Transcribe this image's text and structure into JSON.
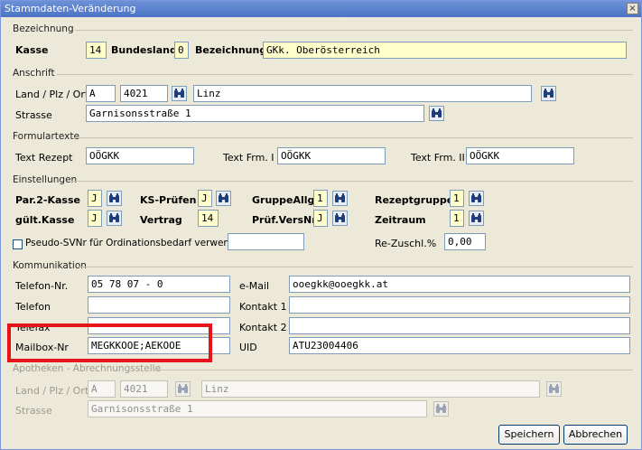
{
  "window": {
    "title": "Stammdaten-Veränderung",
    "close_glyph": "×"
  },
  "bezeichnung": {
    "group_label": "Bezeichnung",
    "kasse_label": "Kasse",
    "kasse_value": "14",
    "bundesland_label": "Bundesland",
    "bundesland_value": "0",
    "bezeichnung_label": "Bezeichnung",
    "bezeichnung_value": "GKk. Oberösterreich"
  },
  "anschrift": {
    "group_label": "Anschrift",
    "lpo_label": "Land / Plz / Ort",
    "land": "A",
    "plz": "4021",
    "ort": "Linz",
    "strasse_label": "Strasse",
    "strasse": "Garnisonsstraße 1"
  },
  "formulartexte": {
    "group_label": "Formulartexte",
    "rezept_label": "Text Rezept",
    "rezept": "OÖGKK",
    "frm1_label": "Text Frm. I",
    "frm1": "OÖGKK",
    "frm2_label": "Text Frm. II",
    "frm2": "OÖGKK"
  },
  "einstellungen": {
    "group_label": "Einstellungen",
    "par2_label": "Par.2-Kasse",
    "par2": "J",
    "ksp_label": "KS-Prüfen",
    "ksp": "J",
    "gruppe_label": "GruppeAllg",
    "gruppe": "1",
    "rezeptgruppe_label": "Rezeptgruppe",
    "rezeptgruppe": "1",
    "gueltig_label": "gült.Kasse",
    "gueltig": "J",
    "vertrag_label": "Vertrag",
    "vertrag": "14",
    "pruef_label": "Prüf.VersNr",
    "pruef": "J",
    "zeitraum_label": "Zeitraum",
    "zeitraum": "1",
    "pseudo_label": "Pseudo-SVNr für Ordinationsbedarf verwenden:",
    "pseudo_value": "",
    "rezuschl_label": "Re-Zuschl.%",
    "rezuschl": "0,00"
  },
  "kommunikation": {
    "group_label": "Kommunikation",
    "telefon_nr_label": "Telefon-Nr.",
    "telefon_nr": "05 78 07 - 0",
    "telefon_label": "Telefon",
    "telefon": "",
    "telefax_label": "Telefax",
    "telefax": "",
    "mailbox_label": "Mailbox-Nr",
    "mailbox": "MEGKKOOE;AEKOOE",
    "email_label": "e-Mail",
    "email": "ooegkk@ooegkk.at",
    "kontakt1_label": "Kontakt 1",
    "kontakt1": "",
    "kontakt2_label": "Kontakt 2",
    "kontakt2": "",
    "uid_label": "UID",
    "uid": "ATU23004406"
  },
  "apotheken": {
    "group_label": "Apotheken - Abrechnungsstelle",
    "lpo_label": "Land / Plz / Ort",
    "land": "A",
    "plz": "4021",
    "ort": "Linz",
    "strasse_label": "Strasse",
    "strasse": "Garnisonsstraße 1"
  },
  "buttons": {
    "save": "Speichern",
    "cancel": "Abbrechen"
  },
  "colors": {
    "highlight": "#e5131b",
    "required_field": "#ffffcc"
  },
  "icons": {
    "lookup": "binoculars-icon"
  }
}
